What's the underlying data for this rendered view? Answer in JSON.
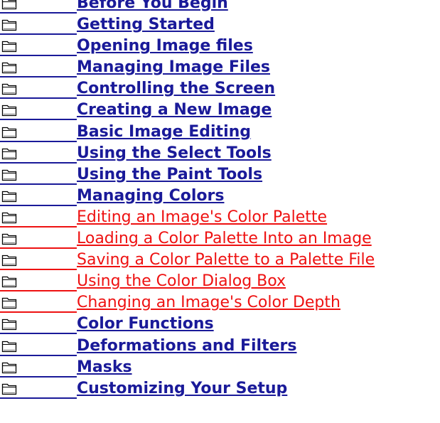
{
  "topics": [
    {
      "label": "Before You Begin",
      "style": "bold"
    },
    {
      "label": "Getting Started",
      "style": "bold"
    },
    {
      "label": "Opening Image files",
      "style": "bold"
    },
    {
      "label": "Managing Image Files",
      "style": "bold"
    },
    {
      "label": "Controlling the Screen",
      "style": "bold"
    },
    {
      "label": "Creating a New Image",
      "style": "bold"
    },
    {
      "label": "Basic Image Editing",
      "style": "bold"
    },
    {
      "label": "Using the Select Tools",
      "style": "bold"
    },
    {
      "label": "Using the Paint Tools",
      "style": "bold"
    },
    {
      "label": "Managing Colors",
      "style": "bold"
    },
    {
      "label": "Editing an Image's Color Palette",
      "style": "sub"
    },
    {
      "label": "Loading a Color Palette Into an Image",
      "style": "sub"
    },
    {
      "label": "Saving a Color Palette to a Palette File",
      "style": "sub"
    },
    {
      "label": "Using the Color Dialog Box",
      "style": "sub"
    },
    {
      "label": "Changing an Image's Color Depth",
      "style": "sub"
    },
    {
      "label": "Color Functions",
      "style": "bold"
    },
    {
      "label": "Deformations and Filters",
      "style": "bold"
    },
    {
      "label": "Masks",
      "style": "bold"
    },
    {
      "label": "Customizing Your Setup",
      "style": "bold"
    }
  ],
  "colors": {
    "link_bold": "#1a1a99",
    "link_sub": "#ee1111",
    "folder_outline": "#000000",
    "folder_fill": "#ffffff"
  },
  "icon": "folder-icon"
}
